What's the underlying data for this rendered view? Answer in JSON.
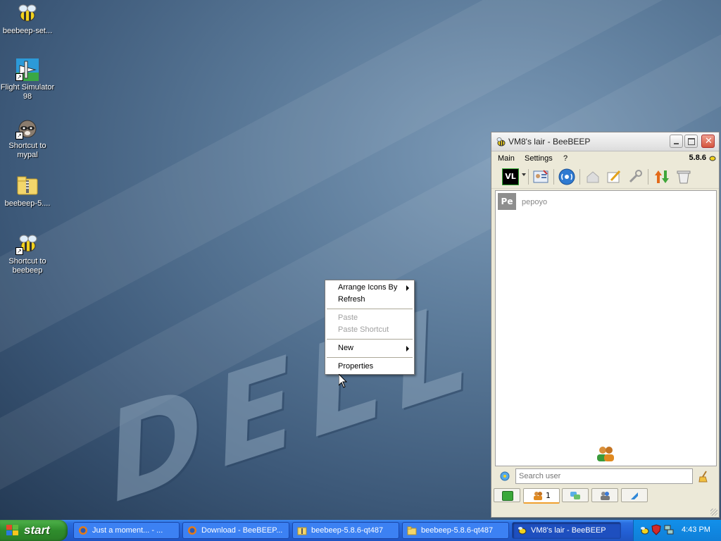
{
  "desktop": {
    "icons": [
      {
        "label": "beebeep-set...",
        "icon": "bee-installer-icon"
      },
      {
        "label": "Flight Simulator 98",
        "icon": "airplane-icon"
      },
      {
        "label": "Shortcut to mypal",
        "icon": "raccoon-icon"
      },
      {
        "label": "beebeep-5....",
        "icon": "zip-folder-icon"
      },
      {
        "label": "Shortcut to beebeep",
        "icon": "bee-icon"
      }
    ]
  },
  "context_menu": {
    "items": [
      {
        "label": "Arrange Icons By",
        "submenu": true,
        "enabled": true
      },
      {
        "label": "Refresh",
        "enabled": true
      },
      {
        "label": "Paste",
        "enabled": false
      },
      {
        "label": "Paste Shortcut",
        "enabled": false
      },
      {
        "label": "New",
        "submenu": true,
        "enabled": true
      },
      {
        "label": "Properties",
        "enabled": true
      }
    ]
  },
  "window": {
    "title": "VM8's lair - BeeBEEP",
    "version": "5.8.6",
    "menu": [
      "Main",
      "Settings",
      "?"
    ],
    "status_badge": "VL",
    "users": [
      {
        "initials": "Pe",
        "name": "pepoyo"
      }
    ],
    "search_placeholder": "Search user",
    "user_tab_count": "1"
  },
  "taskbar": {
    "start_label": "start",
    "tasks": [
      {
        "label": "Just a moment... - ...",
        "icon": "firefox-icon"
      },
      {
        "label": "Download - BeeBEEP...",
        "icon": "firefox-icon"
      },
      {
        "label": "beebeep-5.8.6-qt487",
        "icon": "zip-folder-icon"
      },
      {
        "label": "beebeep-5.8.6-qt487",
        "icon": "folder-icon"
      },
      {
        "label": "VM8's lair - BeeBEEP",
        "icon": "bee-icon"
      }
    ],
    "clock": "4:43 PM"
  },
  "colors": {
    "taskbar": "#245edb",
    "start": "#2f8c2c",
    "accent": "#f0a030"
  }
}
